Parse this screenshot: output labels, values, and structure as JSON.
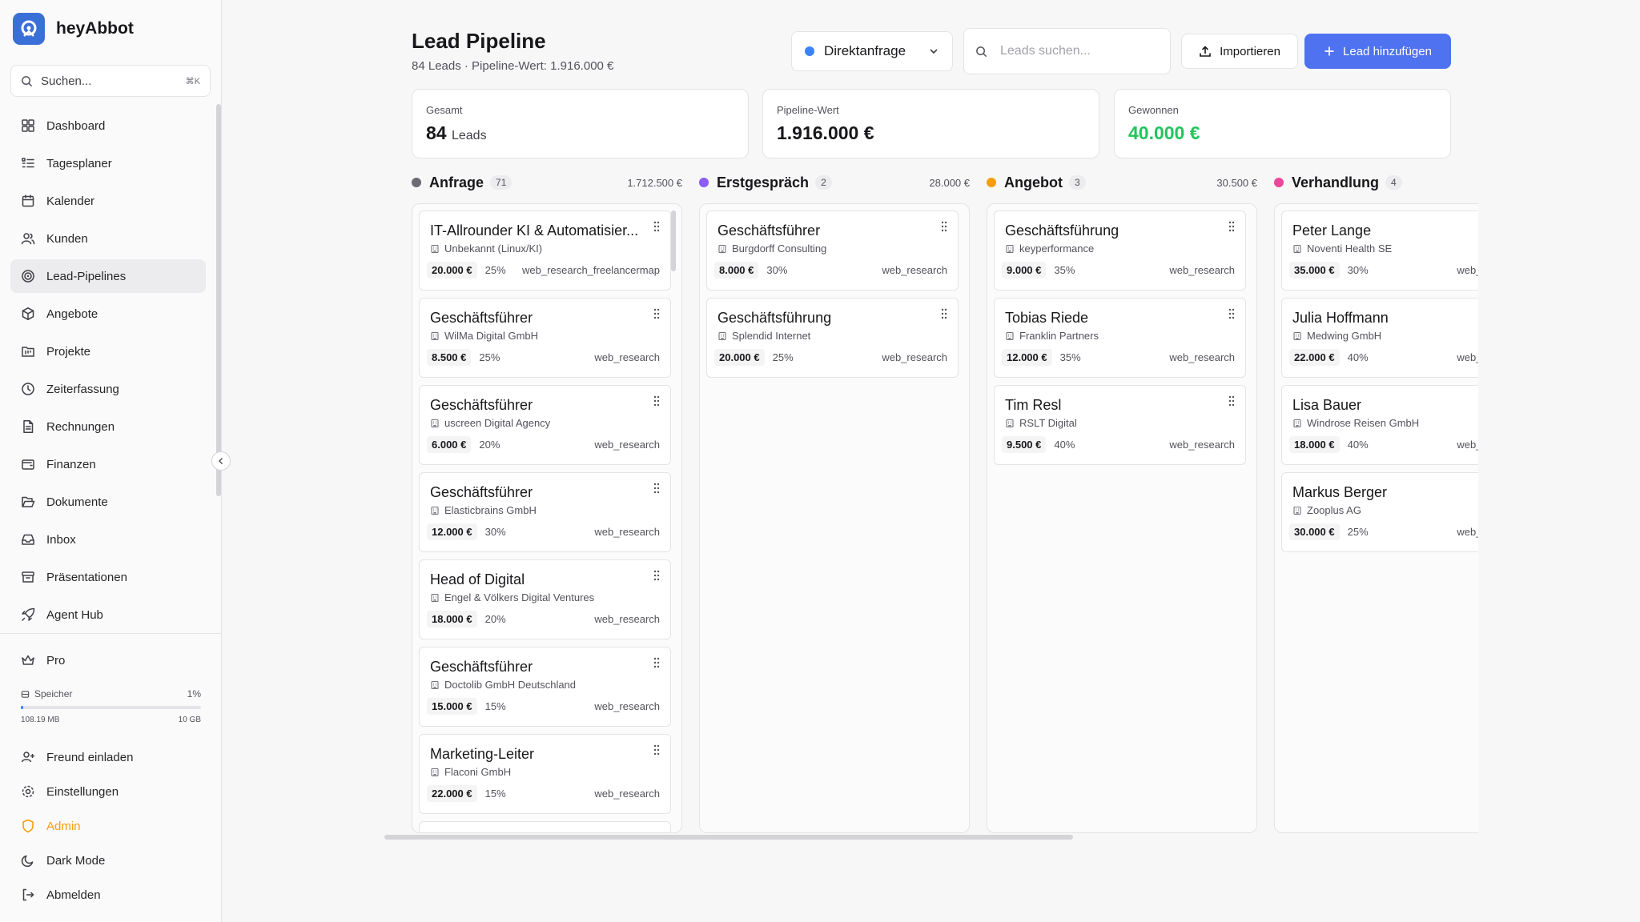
{
  "brand": {
    "name": "heyAbbot"
  },
  "sidebar": {
    "search_label": "Suchen...",
    "search_shortcut": "⌘K",
    "items": [
      {
        "label": "Dashboard",
        "icon": "dashboard-icon"
      },
      {
        "label": "Tagesplaner",
        "icon": "list-icon"
      },
      {
        "label": "Kalender",
        "icon": "calendar-icon"
      },
      {
        "label": "Kunden",
        "icon": "users-icon"
      },
      {
        "label": "Lead-Pipelines",
        "icon": "target-icon",
        "active": true
      },
      {
        "label": "Angebote",
        "icon": "package-icon"
      },
      {
        "label": "Projekte",
        "icon": "folder-kanban-icon"
      },
      {
        "label": "Zeiterfassung",
        "icon": "clock-icon"
      },
      {
        "label": "Rechnungen",
        "icon": "file-text-icon"
      },
      {
        "label": "Finanzen",
        "icon": "wallet-icon"
      },
      {
        "label": "Dokumente",
        "icon": "folder-open-icon"
      },
      {
        "label": "Inbox",
        "icon": "inbox-icon"
      },
      {
        "label": "Präsentationen",
        "icon": "archive-icon"
      },
      {
        "label": "Agent Hub",
        "icon": "rocket-icon"
      }
    ],
    "plan_label": "Pro",
    "storage": {
      "label": "Speicher",
      "percent_label": "1%",
      "fraction": 0.01,
      "used": "108.19 MB",
      "total": "10 GB"
    },
    "bottom": {
      "invite": "Freund einladen",
      "settings": "Einstellungen",
      "admin": "Admin",
      "dark_mode": "Dark Mode",
      "logout": "Abmelden"
    }
  },
  "header": {
    "title": "Lead Pipeline",
    "subtitle": "84 Leads · Pipeline-Wert: 1.916.000 €",
    "filter_value": "Direktanfrage",
    "search_placeholder": "Leads suchen...",
    "import_label": "Importieren",
    "add_label": "Lead hinzufügen"
  },
  "stats": {
    "total": {
      "label": "Gesamt",
      "value": "84",
      "unit": "Leads"
    },
    "pipeline": {
      "label": "Pipeline-Wert",
      "value": "1.916.000 €"
    },
    "won": {
      "label": "Gewonnen",
      "value": "40.000 €"
    }
  },
  "colors": {
    "anfrage": "#6b6b73",
    "erstgespraech": "#8b5cf6",
    "angebot": "#f59e0b",
    "verhandlung": "#ec4899",
    "accent": "#4f72f0",
    "won": "#22c55e"
  },
  "columns": [
    {
      "name": "Anfrage",
      "count": "71",
      "sum": "1.712.500 €",
      "cards": [
        {
          "title": "IT-Allrounder KI & Automatisier...",
          "company": "Unbekannt (Linux/KI)",
          "amount": "20.000 €",
          "prob": "25%",
          "source": "web_research_freelancermap"
        },
        {
          "title": "Geschäftsführer",
          "company": "WilMa Digital GmbH",
          "amount": "8.500 €",
          "prob": "25%",
          "source": "web_research"
        },
        {
          "title": "Geschäftsführer",
          "company": "uscreen Digital Agency",
          "amount": "6.000 €",
          "prob": "20%",
          "source": "web_research"
        },
        {
          "title": "Geschäftsführer",
          "company": "Elasticbrains GmbH",
          "amount": "12.000 €",
          "prob": "30%",
          "source": "web_research"
        },
        {
          "title": "Head of Digital",
          "company": "Engel & Völkers Digital Ventures",
          "amount": "18.000 €",
          "prob": "20%",
          "source": "web_research"
        },
        {
          "title": "Geschäftsführer",
          "company": "Doctolib GmbH Deutschland",
          "amount": "15.000 €",
          "prob": "15%",
          "source": "web_research"
        },
        {
          "title": "Marketing-Leiter",
          "company": "Flaconi GmbH",
          "amount": "22.000 €",
          "prob": "15%",
          "source": "web_research"
        }
      ]
    },
    {
      "name": "Erstgespräch",
      "count": "2",
      "sum": "28.000 €",
      "cards": [
        {
          "title": "Geschäftsführer",
          "company": "Burgdorff Consulting",
          "amount": "8.000 €",
          "prob": "30%",
          "source": "web_research"
        },
        {
          "title": "Geschäftsführung",
          "company": "Splendid Internet",
          "amount": "20.000 €",
          "prob": "25%",
          "source": "web_research"
        }
      ]
    },
    {
      "name": "Angebot",
      "count": "3",
      "sum": "30.500 €",
      "cards": [
        {
          "title": "Geschäftsführung",
          "company": "keyperformance",
          "amount": "9.000 €",
          "prob": "35%",
          "source": "web_research"
        },
        {
          "title": "Tobias Riede",
          "company": "Franklin Partners",
          "amount": "12.000 €",
          "prob": "35%",
          "source": "web_research"
        },
        {
          "title": "Tim Resl",
          "company": "RSLT Digital",
          "amount": "9.500 €",
          "prob": "40%",
          "source": "web_research"
        }
      ]
    },
    {
      "name": "Verhandlung",
      "count": "4",
      "sum": "",
      "cards": [
        {
          "title": "Peter Lange",
          "company": "Noventi Health SE",
          "amount": "35.000 €",
          "prob": "30%",
          "source": "web_research"
        },
        {
          "title": "Julia Hoffmann",
          "company": "Medwing GmbH",
          "amount": "22.000 €",
          "prob": "40%",
          "source": "web_research"
        },
        {
          "title": "Lisa Bauer",
          "company": "Windrose Reisen GmbH",
          "amount": "18.000 €",
          "prob": "40%",
          "source": "web_research"
        },
        {
          "title": "Markus Berger",
          "company": "Zooplus AG",
          "amount": "30.000 €",
          "prob": "25%",
          "source": "web_research"
        }
      ]
    }
  ]
}
